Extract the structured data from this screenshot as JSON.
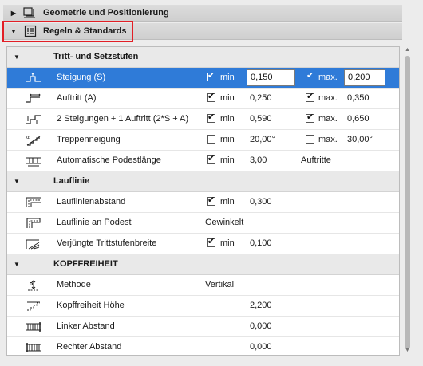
{
  "panels": [
    {
      "title": "Geometrie und Positionierung",
      "expanded": false,
      "icon": "geometry-icon"
    },
    {
      "title": "Regeln & Standards",
      "expanded": true,
      "icon": "rules-icon"
    }
  ],
  "groups": [
    {
      "title": "Tritt- und Setzstufen",
      "rows": [
        {
          "label": "Steigung (S)",
          "icon": "riser-icon",
          "selected": true,
          "min_checked": true,
          "min_label": "min",
          "min_value": "0,150",
          "max_checked": true,
          "max_label": "max.",
          "max_value": "0,200",
          "editable": true
        },
        {
          "label": "Auftritt (A)",
          "icon": "tread-icon",
          "min_checked": true,
          "min_label": "min",
          "min_value": "0,250",
          "max_checked": true,
          "max_label": "max.",
          "max_value": "0,350"
        },
        {
          "label": "2 Steigungen + 1 Auftritt (2*S + A)",
          "icon": "step-formula-icon",
          "min_checked": true,
          "min_label": "min",
          "min_value": "0,590",
          "max_checked": true,
          "max_label": "max.",
          "max_value": "0,650"
        },
        {
          "label": "Treppenneigung",
          "icon": "stair-slope-icon",
          "min_checked": false,
          "min_label": "min",
          "min_value": "20,00°",
          "max_checked": false,
          "max_label": "max.",
          "max_value": "30,00°"
        },
        {
          "label": "Automatische Podestlänge",
          "icon": "landing-length-icon",
          "min_checked": true,
          "min_label": "min",
          "min_value": "3,00",
          "extra": "Auftritte"
        }
      ]
    },
    {
      "title": "Lauflinie",
      "rows": [
        {
          "label": "Lauflinienabstand",
          "icon": "walkline-offset-icon",
          "min_checked": true,
          "min_label": "min",
          "min_value": "0,300"
        },
        {
          "label": "Lauflinie an Podest",
          "icon": "walkline-landing-icon",
          "text_value": "Gewinkelt"
        },
        {
          "label": "Verjüngte Trittstufenbreite",
          "icon": "tapered-tread-icon",
          "min_checked": true,
          "min_label": "min",
          "min_value": "0,100"
        }
      ]
    },
    {
      "title": "KOPFFREIHEIT",
      "rows": [
        {
          "label": "Methode",
          "icon": "method-icon",
          "text_value": "Vertikal"
        },
        {
          "label": "Kopffreiheit Höhe",
          "icon": "headroom-height-icon",
          "value": "2,200"
        },
        {
          "label": "Linker Abstand",
          "icon": "left-clearance-icon",
          "value": "0,000"
        },
        {
          "label": "Rechter Abstand",
          "icon": "right-clearance-icon",
          "value": "0,000"
        }
      ]
    }
  ],
  "colors": {
    "selection": "#2f7bd8",
    "highlight_border": "#e21f26"
  }
}
